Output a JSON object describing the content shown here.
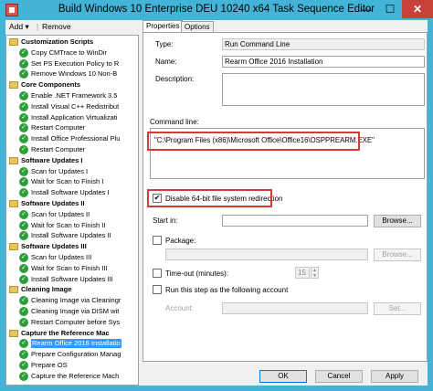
{
  "window": {
    "title": "Build Windows 10 Enterprise DEU 10240 x64 Task Sequence Editor",
    "controls": {
      "minimize": "—",
      "maximize": "☐",
      "close": "✕"
    }
  },
  "toolbar": {
    "add_label": "Add ▾",
    "remove_label": "Remove"
  },
  "tree": {
    "items": [
      {
        "label": "Customization Scripts",
        "type": "group"
      },
      {
        "label": "Copy CMTrace to WinDir",
        "type": "step"
      },
      {
        "label": "Set PS Execution Policy to R",
        "type": "step"
      },
      {
        "label": "Remove Windows 10 Non-B",
        "type": "step"
      },
      {
        "label": "Core Components",
        "type": "group"
      },
      {
        "label": "Enable .NET Framework 3.5",
        "type": "step"
      },
      {
        "label": "Install Visual C++ Redistribut",
        "type": "step"
      },
      {
        "label": "Install Application Virtualizati",
        "type": "step"
      },
      {
        "label": "Restart Computer",
        "type": "step"
      },
      {
        "label": "Install Office Professional Plu",
        "type": "step"
      },
      {
        "label": "Restart Computer",
        "type": "step"
      },
      {
        "label": "Software Updates I",
        "type": "group"
      },
      {
        "label": "Scan for Updates I",
        "type": "step"
      },
      {
        "label": "Wait for Scan to Finish I",
        "type": "step"
      },
      {
        "label": "Install Software Updates I",
        "type": "step"
      },
      {
        "label": "Software Updates II",
        "type": "group"
      },
      {
        "label": "Scan for Updates II",
        "type": "step"
      },
      {
        "label": "Wait for Scan to Finish II",
        "type": "step"
      },
      {
        "label": "Install Software Updates II",
        "type": "step"
      },
      {
        "label": "Software Updates III",
        "type": "group"
      },
      {
        "label": "Scan for Updates III",
        "type": "step"
      },
      {
        "label": "Wait for Scan to Finish III",
        "type": "step"
      },
      {
        "label": "Install Software Updates III",
        "type": "step"
      },
      {
        "label": "Cleaning Image",
        "type": "group"
      },
      {
        "label": "Cleaning Image via Cleaningr",
        "type": "step"
      },
      {
        "label": "Cleaning Image via DISM wit",
        "type": "step"
      },
      {
        "label": "Restart Computer before Sys",
        "type": "step"
      },
      {
        "label": "Capture the Reference Mac",
        "type": "group"
      },
      {
        "label": "Rearm Office 2016 Installatio",
        "type": "step",
        "selected": true
      },
      {
        "label": "Prepare Configuration Manag",
        "type": "step"
      },
      {
        "label": "Prepare OS",
        "type": "step"
      },
      {
        "label": "Capture the Reference Mach",
        "type": "step"
      }
    ]
  },
  "tabs": {
    "properties": "Properties",
    "options": "Options"
  },
  "properties": {
    "type_label": "Type:",
    "type_value": "Run Command Line",
    "name_label": "Name:",
    "name_value": "Rearm Office 2016 Installation",
    "description_label": "Description:",
    "description_value": "",
    "command_line_label": "Command line:",
    "command_line_value": "\"C:\\Program Files (x86)\\Microsoft Office\\Office16\\OSPPREARM.EXE\"",
    "disable_redirection_label": "Disable 64-bit file system redirection",
    "disable_redirection_checked": true,
    "start_in_label": "Start in:",
    "start_in_value": "",
    "browse_label": "Browse...",
    "package_label": "Package:",
    "package_value": "",
    "browse2_label": "Browse...",
    "timeout_label": "Time-out (minutes):",
    "timeout_value": "15",
    "run_as_label": "Run this step as the following account",
    "account_label": "Account:",
    "account_value": "",
    "set_label": "Set..."
  },
  "buttons": {
    "ok": "OK",
    "cancel": "Cancel",
    "apply": "Apply"
  },
  "colors": {
    "title_bar": "#43b4d8",
    "highlight": "#d63a3a",
    "selection": "#3399ff",
    "check": "#2d9e3a"
  }
}
